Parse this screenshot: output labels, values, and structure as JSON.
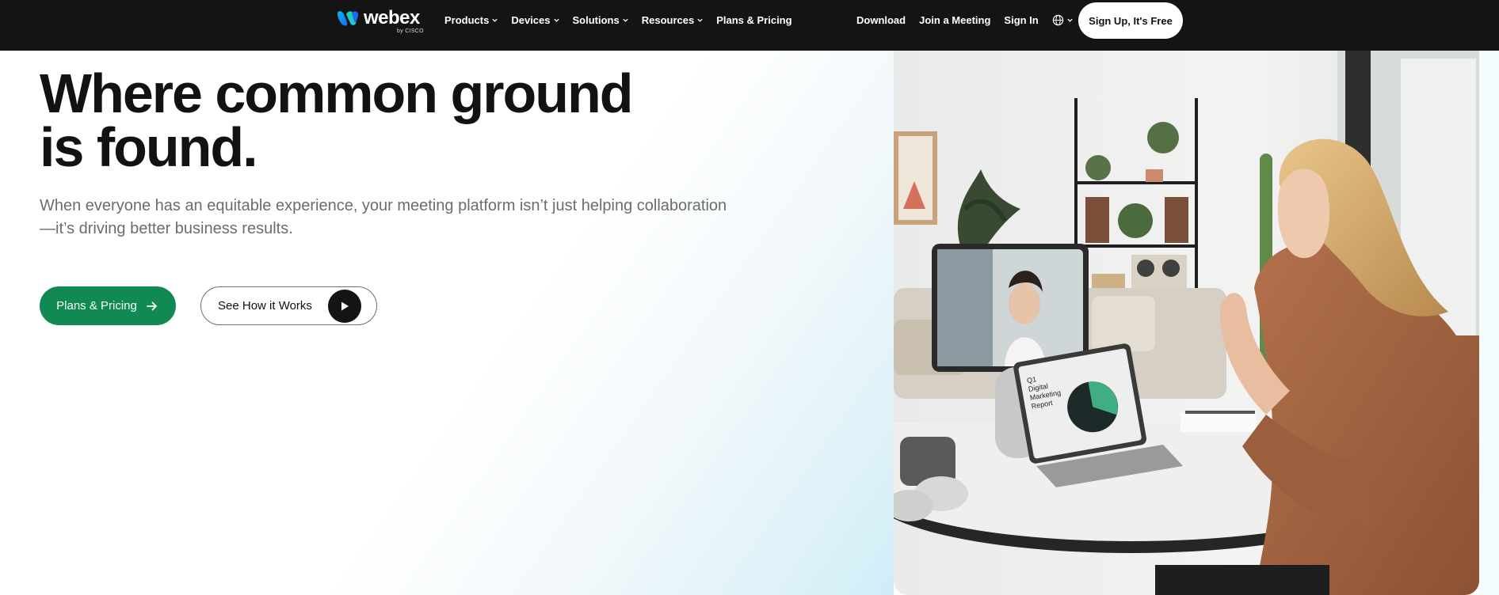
{
  "brand": {
    "name": "webex",
    "byline": "by CISCO"
  },
  "nav": {
    "menu": [
      {
        "label": "Products",
        "has_dropdown": true
      },
      {
        "label": "Devices",
        "has_dropdown": true
      },
      {
        "label": "Solutions",
        "has_dropdown": true
      },
      {
        "label": "Resources",
        "has_dropdown": true
      },
      {
        "label": "Plans & Pricing",
        "has_dropdown": false
      }
    ],
    "right_links": [
      "Download",
      "Join a Meeting",
      "Sign In"
    ],
    "language_icon": "globe-icon",
    "cta": "Sign Up, It's Free"
  },
  "hero": {
    "headline_line1": "Where common ground",
    "headline_line2": "is found.",
    "subtext": "When everyone has an equitable experience, your meeting platform isn’t just helping collaboration—it’s driving better business results.",
    "primary_button": "Plans & Pricing",
    "secondary_button": "See How it Works",
    "image_alt": "",
    "laptop_screen_title_1": "Q1",
    "laptop_screen_title_2": "Digital",
    "laptop_screen_title_3": "Marketing",
    "laptop_screen_title_4": "Report"
  },
  "colors": {
    "nav_bg": "#141414",
    "accent_green": "#108a52",
    "text_dark": "#121212",
    "text_muted": "#6c6c6c"
  }
}
